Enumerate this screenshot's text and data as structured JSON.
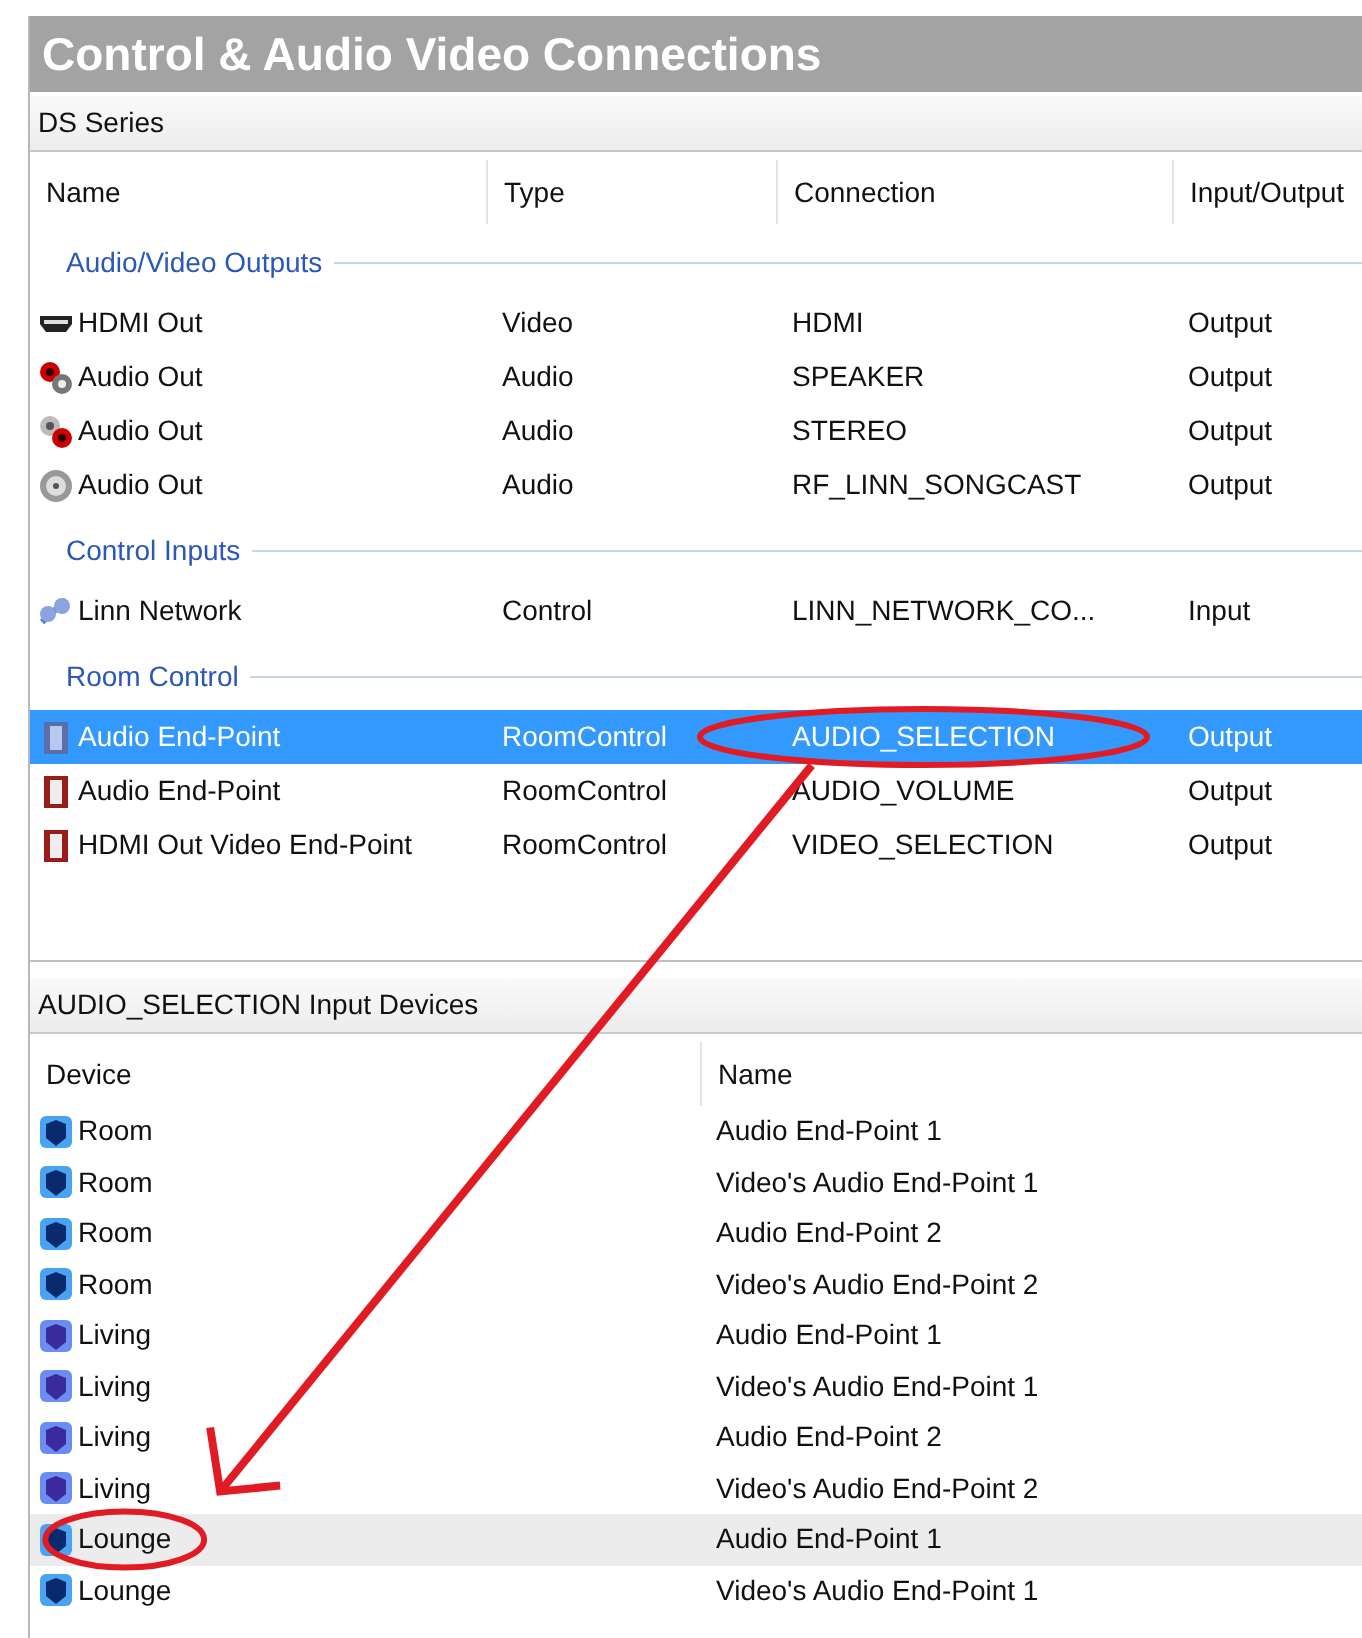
{
  "window": {
    "title": "Control & Audio Video Connections"
  },
  "connections": {
    "title": "DS Series",
    "columns": [
      "Name",
      "Type",
      "Connection",
      "Input/Output"
    ],
    "groups": [
      {
        "label": "Audio/Video Outputs",
        "rows": [
          {
            "kind": "hdmi",
            "name": "HDMI Out",
            "type": "Video",
            "connection": "HDMI",
            "direction": "Output",
            "selected": false
          },
          {
            "kind": "speaker",
            "name": "Audio Out",
            "type": "Audio",
            "connection": "SPEAKER",
            "direction": "Output",
            "selected": false
          },
          {
            "kind": "stereo",
            "name": "Audio Out",
            "type": "Audio",
            "connection": "STEREO",
            "direction": "Output",
            "selected": false
          },
          {
            "kind": "rf",
            "name": "Audio Out",
            "type": "Audio",
            "connection": "RF_LINN_SONGCAST",
            "direction": "Output",
            "selected": false
          }
        ]
      },
      {
        "label": "Control Inputs",
        "rows": [
          {
            "kind": "network",
            "name": "Linn Network",
            "type": "Control",
            "connection": "LINN_NETWORK_CO...",
            "direction": "Input",
            "selected": false
          }
        ]
      },
      {
        "label": "Room Control",
        "rows": [
          {
            "kind": "endpoint",
            "name": "Audio End-Point",
            "type": "RoomControl",
            "connection": "AUDIO_SELECTION",
            "direction": "Output",
            "selected": true
          },
          {
            "kind": "endpoint",
            "name": "Audio End-Point",
            "type": "RoomControl",
            "connection": "AUDIO_VOLUME",
            "direction": "Output",
            "selected": false
          },
          {
            "kind": "endpoint",
            "name": "HDMI Out Video End-Point",
            "type": "RoomControl",
            "connection": "VIDEO_SELECTION",
            "direction": "Output",
            "selected": false
          }
        ]
      }
    ]
  },
  "input_devices": {
    "title": "AUDIO_SELECTION Input Devices",
    "columns": [
      "Device",
      "Name"
    ],
    "rows": [
      {
        "kind": "room",
        "device": "Room",
        "name": "Audio End-Point 1",
        "selected": false
      },
      {
        "kind": "room",
        "device": "Room",
        "name": "Video's Audio End-Point 1",
        "selected": false
      },
      {
        "kind": "room",
        "device": "Room",
        "name": "Audio End-Point 2",
        "selected": false
      },
      {
        "kind": "room",
        "device": "Room",
        "name": "Video's Audio End-Point 2",
        "selected": false
      },
      {
        "kind": "living",
        "device": "Living",
        "name": "Audio End-Point 1",
        "selected": false
      },
      {
        "kind": "living",
        "device": "Living",
        "name": "Video's Audio End-Point 1",
        "selected": false
      },
      {
        "kind": "living",
        "device": "Living",
        "name": "Audio End-Point 2",
        "selected": false
      },
      {
        "kind": "living",
        "device": "Living",
        "name": "Video's Audio End-Point 2",
        "selected": false
      },
      {
        "kind": "room",
        "device": "Lounge",
        "name": "Audio End-Point 1",
        "selected": true
      },
      {
        "kind": "room",
        "device": "Lounge",
        "name": "Video's Audio End-Point 1",
        "selected": false
      }
    ]
  }
}
